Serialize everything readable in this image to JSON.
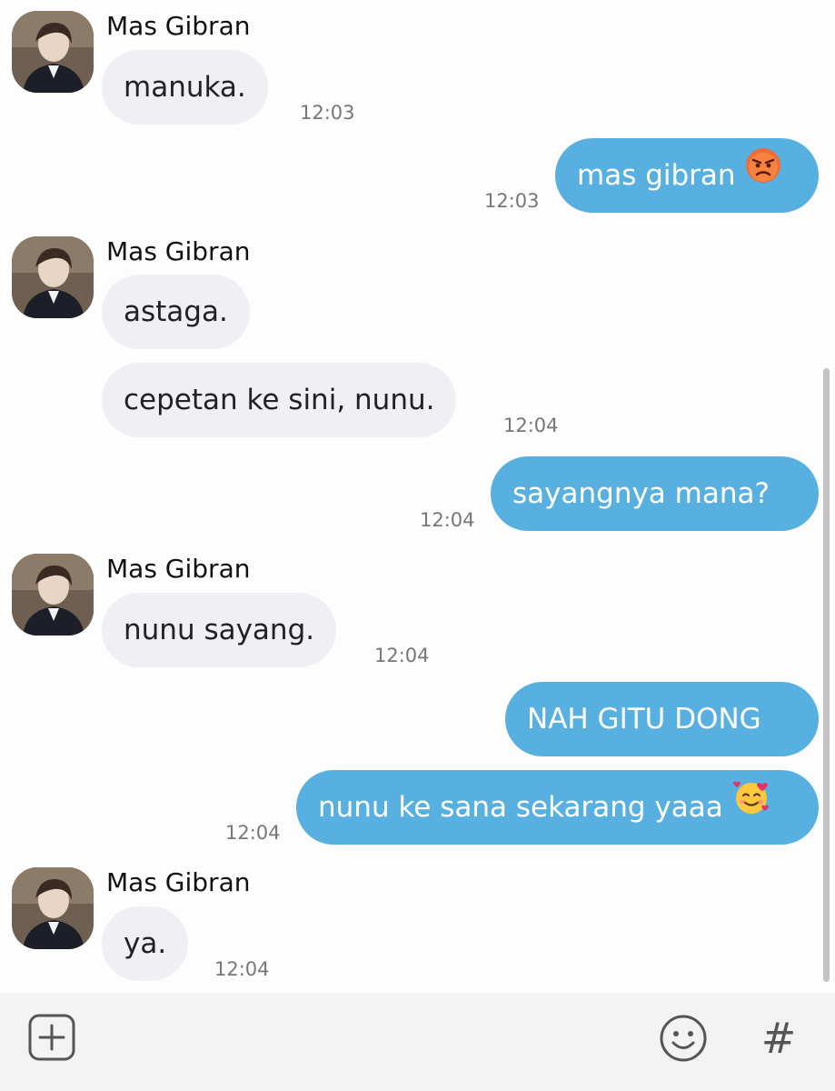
{
  "contact": {
    "name": "Mas Gibran"
  },
  "messages": [
    {
      "id": 1,
      "direction": "in",
      "show_sender": true,
      "sender": "Mas Gibran",
      "text": "manuka.",
      "time": "12:03"
    },
    {
      "id": 2,
      "direction": "out",
      "text": "mas gibran",
      "emoji": "angry-face",
      "time": "12:03"
    },
    {
      "id": 3,
      "direction": "in",
      "show_sender": true,
      "sender": "Mas Gibran",
      "text": "astaga.",
      "time": ""
    },
    {
      "id": 4,
      "direction": "in",
      "show_sender": false,
      "text": "cepetan ke sini, nunu.",
      "time": "12:04"
    },
    {
      "id": 5,
      "direction": "out",
      "text": "sayangnya mana?",
      "time": "12:04"
    },
    {
      "id": 6,
      "direction": "in",
      "show_sender": true,
      "sender": "Mas Gibran",
      "text": "nunu sayang.",
      "time": "12:04"
    },
    {
      "id": 7,
      "direction": "out",
      "text": "NAH GITU DONG",
      "time": ""
    },
    {
      "id": 8,
      "direction": "out",
      "text": "nunu ke sana sekarang yaaa",
      "emoji": "smiling-face-with-hearts",
      "time": "12:04"
    },
    {
      "id": 9,
      "direction": "in",
      "show_sender": true,
      "sender": "Mas Gibran",
      "text": "ya.",
      "time": "12:04"
    }
  ],
  "input_bar": {
    "add_icon": "plus-square-icon",
    "emoji_icon": "smiley-icon",
    "hashtag_icon": "hashtag-icon",
    "hashtag_glyph": "#"
  },
  "colors": {
    "outgoing_bubble": "#58b0e1",
    "incoming_bubble": "#f0f0f4",
    "background": "#fdfdfd",
    "input_bar": "#f3f3f3"
  }
}
